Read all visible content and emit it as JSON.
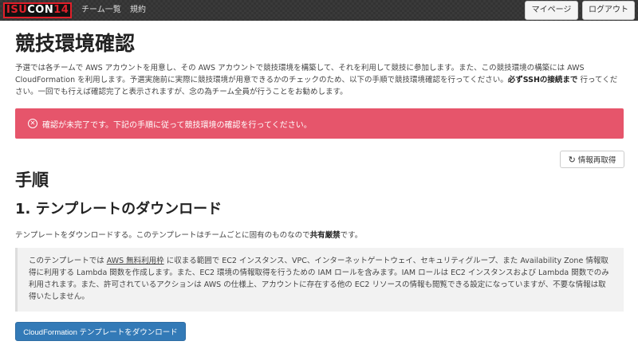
{
  "navbar": {
    "brand": {
      "part1": "ISU",
      "part2": "CON",
      "part3": "14"
    },
    "links": [
      "チーム一覧",
      "規約"
    ],
    "mypage_label": "マイページ",
    "logout_label": "ログアウト"
  },
  "page": {
    "title": "競技環境確認",
    "intro_1": "予選では各チームで AWS アカウントを用意し、その AWS アカウントで競技環境を構築して、それを利用して競技に参加します。また、この競技環境の構築には AWS CloudFormation を利用します。予選実施前に実際に競技環境が用意できるかのチェックのため、以下の手順で競技環境確認を行ってください。",
    "intro_bold": "必ずSSHの接続まで",
    "intro_2": " 行ってください。一回でも行えば確認完了と表示されますが、念の為チーム全員が行うことをお勧めします。"
  },
  "alert": {
    "icon": "x-circle-icon",
    "message": "確認が未完了です。下記の手順に従って競技環境の確認を行ってください。"
  },
  "refresh_button": {
    "icon": "refresh-icon",
    "label": "情報再取得"
  },
  "procedure": {
    "heading": "手順",
    "step1": {
      "title": "1. テンプレートのダウンロード",
      "desc_1": "テンプレートをダウンロードする。このテンプレートはチームごとに固有のものなので",
      "desc_bold": "共有厳禁",
      "desc_2": "です。",
      "note_1": "このテンプレートでは ",
      "note_link": "AWS 無料利用枠",
      "note_2": " に収まる範囲で EC2 インスタンス、VPC、インターネットゲートウェイ、セキュリティグループ、また Availability Zone 情報取得に利用する Lambda 関数を作成します。また、EC2 環境の情報取得を行うための IAM ロールを含みます。IAM ロールは EC2 インスタンスおよび Lambda 関数でのみ利用されます。また、許可されているアクションは AWS の仕様上、アカウントに存在する他の EC2 リソースの情報も閲覧できる設定になっていますが、不要な情報は取得いたしません。",
      "download_label": "CloudFormation テンプレートをダウンロード"
    }
  }
}
